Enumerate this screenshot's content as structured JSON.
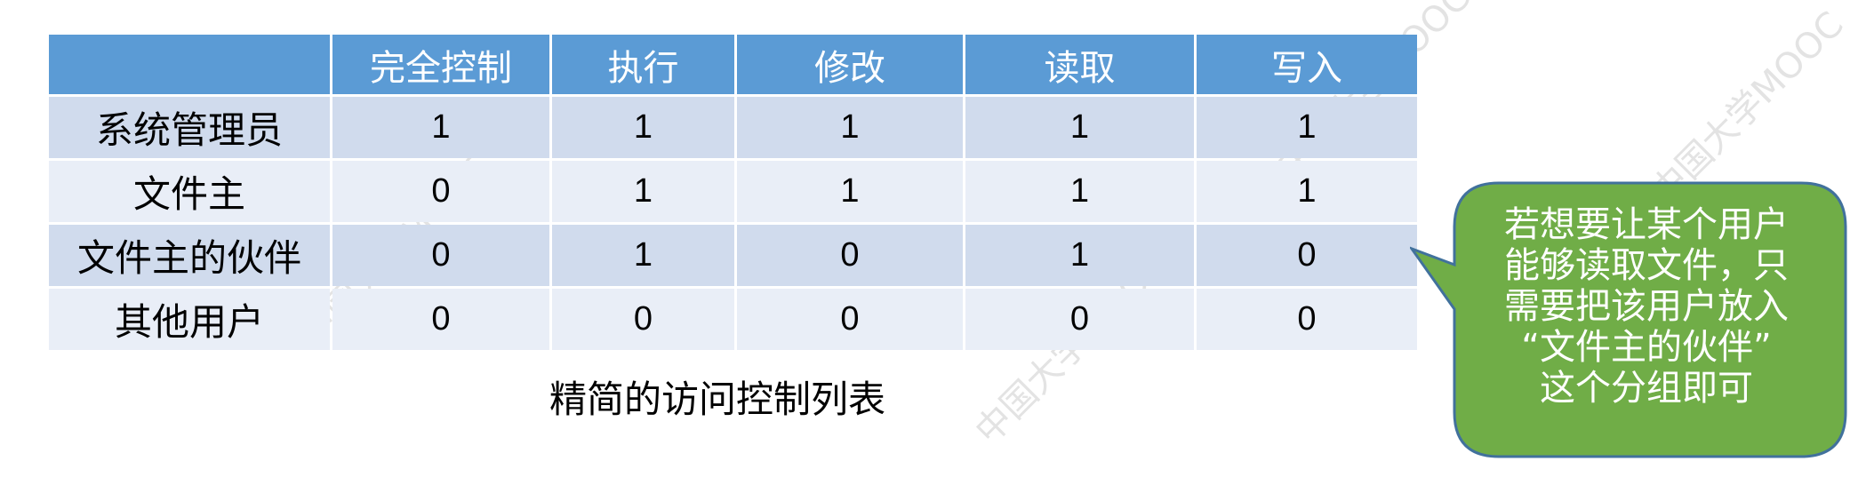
{
  "table": {
    "headers": [
      "",
      "完全控制",
      "执行",
      "修改",
      "读取",
      "写入"
    ],
    "rows": [
      {
        "label": "系统管理员",
        "values": [
          "1",
          "1",
          "1",
          "1",
          "1"
        ]
      },
      {
        "label": "文件主",
        "values": [
          "0",
          "1",
          "1",
          "1",
          "1"
        ]
      },
      {
        "label": "文件主的伙伴",
        "values": [
          "0",
          "1",
          "0",
          "1",
          "0"
        ]
      },
      {
        "label": "其他用户",
        "values": [
          "0",
          "0",
          "0",
          "0",
          "0"
        ]
      }
    ]
  },
  "caption": "精简的访问控制列表",
  "callout": {
    "lines": [
      "若想要让某个用户",
      "能够读取文件，只",
      "需要把该用户放入",
      "“文件主的伙伴”",
      "这个分组即可"
    ],
    "fill": "#70ad47",
    "stroke": "#41719c"
  },
  "colors": {
    "header_bg": "#5b9bd5",
    "row_dark": "#d0dbed",
    "row_light": "#e9eef7"
  }
}
